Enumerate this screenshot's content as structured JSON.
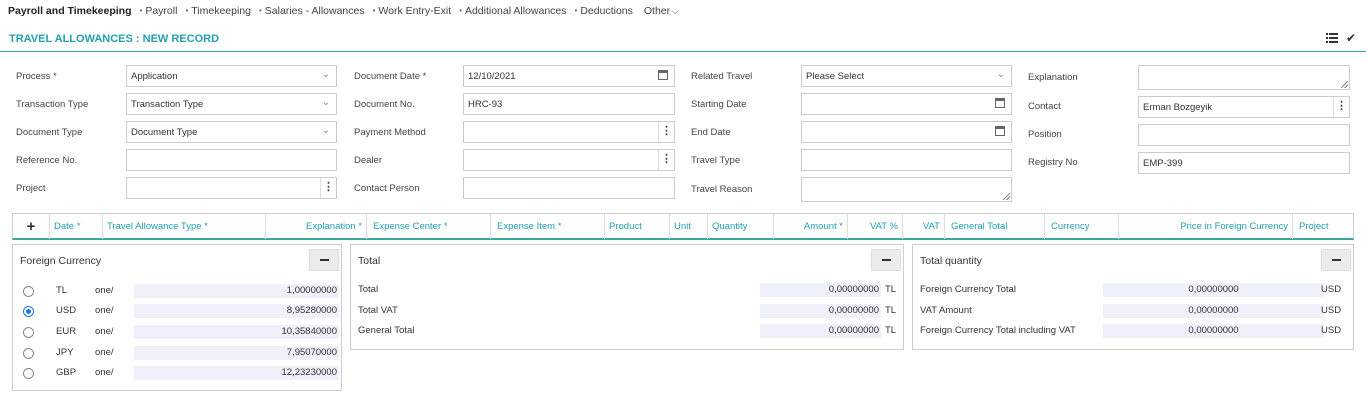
{
  "nav": {
    "brand": "Payroll and Timekeeping",
    "items": [
      "Payroll",
      "Timekeeping",
      "Salaries - Allowances",
      "Work Entry-Exit",
      "Additional Allowances",
      "Deductions"
    ],
    "other": "Other"
  },
  "header": {
    "title": "TRAVEL ALLOWANCES : NEW RECORD"
  },
  "form": {
    "process_label": "Process *",
    "process_value": "Application",
    "transaction_type_label": "Transaction Type",
    "transaction_type_value": "Transaction Type",
    "document_type_label": "Document Type",
    "document_type_value": "Document Type",
    "reference_no_label": "Reference No.",
    "reference_no_value": "",
    "project_label": "Project",
    "project_value": "",
    "document_date_label": "Document Date *",
    "document_date_value": "12/10/2021",
    "document_no_label": "Document No.",
    "document_no_value": "HRC-93",
    "payment_method_label": "Payment Method",
    "payment_method_value": "",
    "dealer_label": "Dealer",
    "dealer_value": "",
    "contact_person_label": "Contact Person",
    "contact_person_value": "",
    "related_travel_label": "Related Travel",
    "related_travel_value": "Please Select",
    "starting_date_label": "Starting Date",
    "starting_date_value": "",
    "end_date_label": "End Date",
    "end_date_value": "",
    "travel_type_label": "Travel Type",
    "travel_type_value": "",
    "travel_reason_label": "Travel Reason",
    "travel_reason_value": "",
    "explanation_label": "Explanation",
    "explanation_value": "",
    "contact_label": "Contact",
    "contact_value": "Erman Bozgeyik",
    "position_label": "Position",
    "position_value": "",
    "registry_no_label": "Registry No",
    "registry_no_value": "EMP-399"
  },
  "grid": {
    "add": "+",
    "columns": [
      "Date *",
      "Travel Allowance Type *",
      "Explanation *",
      "Expense Center *",
      "Expense Item *",
      "Product",
      "Unit",
      "Quantity",
      "Amount *",
      "VAT %",
      "VAT",
      "General Total",
      "Currency",
      "Price in Foreign Currency",
      "Project"
    ]
  },
  "foreign_currency": {
    "title": "Foreign Currency",
    "rows": [
      {
        "code": "TL",
        "unit": "one/",
        "rate": "1,00000000",
        "selected": false
      },
      {
        "code": "USD",
        "unit": "one/",
        "rate": "8,95280000",
        "selected": true
      },
      {
        "code": "EUR",
        "unit": "one/",
        "rate": "10,35840000",
        "selected": false
      },
      {
        "code": "JPY",
        "unit": "one/",
        "rate": "7,95070000",
        "selected": false
      },
      {
        "code": "GBP",
        "unit": "one/",
        "rate": "12,23230000",
        "selected": false
      }
    ]
  },
  "total": {
    "title": "Total",
    "rows": [
      {
        "label": "Total",
        "value": "0,00000000",
        "currency": "TL"
      },
      {
        "label": "Total VAT",
        "value": "0,00000000",
        "currency": "TL"
      },
      {
        "label": "General Total",
        "value": "0,00000000",
        "currency": "TL"
      }
    ]
  },
  "total_quantity": {
    "title": "Total quantity",
    "rows": [
      {
        "label": "Foreign Currency Total",
        "value": "0,00000000",
        "currency": "USD"
      },
      {
        "label": "VAT Amount",
        "value": "0,00000000",
        "currency": "USD"
      },
      {
        "label": "Foreign Currency Total including VAT",
        "value": "0,00000000",
        "currency": "USD"
      }
    ]
  },
  "colors": {
    "accent": "#25a0b0",
    "rule": "#3aa7a1",
    "value_bg": "#eef0fa"
  },
  "icons": [
    "list-icon",
    "check-icon",
    "chevron-down-icon",
    "calendar-icon",
    "more-vertical-icon",
    "plus-icon",
    "minus-icon"
  ]
}
